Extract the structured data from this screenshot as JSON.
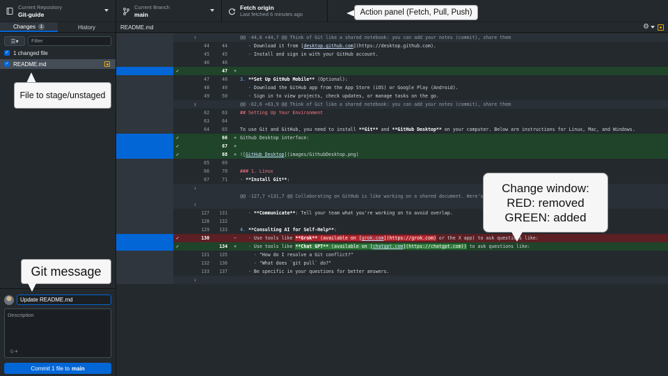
{
  "toolbar": {
    "repo": {
      "label": "Current Repository",
      "value": "Git-guide"
    },
    "branch": {
      "label": "Current Branch",
      "value": "main"
    },
    "fetch": {
      "label": "Fetch origin",
      "value": "Last fetched 6 minutes ago"
    }
  },
  "sidebar": {
    "tabs": [
      {
        "label": "Changes",
        "badge": "1"
      },
      {
        "label": "History"
      }
    ],
    "filter_placeholder": "Filter",
    "changed_count": "1 changed file",
    "file": "README.md"
  },
  "commit": {
    "summary": "Update README.md",
    "description_placeholder": "Description",
    "button_prefix": "Commit 1 file to",
    "button_branch": "main"
  },
  "diff": {
    "filename": "README.md",
    "lines": [
      {
        "type": "hunk",
        "expand": "up",
        "old": "",
        "new": "",
        "mark": "",
        "text": "@@ -44,6 +44,7 @@ Think of Git like a shared notebook: you can add your notes (commit), share them"
      },
      {
        "type": "ctx",
        "old": "44",
        "new": "44",
        "mark": "",
        "text": "   - Download it from [desktop.github.com](https://desktop.github.com)."
      },
      {
        "type": "ctx",
        "old": "45",
        "new": "45",
        "mark": "",
        "text": "   - Install and sign in with your GitHub account."
      },
      {
        "type": "ctx",
        "old": "46",
        "new": "46",
        "mark": "",
        "text": ""
      },
      {
        "type": "add",
        "sel": true,
        "old": "",
        "new": "47",
        "mark": "+",
        "text": ""
      },
      {
        "type": "ctx",
        "old": "47",
        "new": "48",
        "mark": "",
        "text": "3. **Set Up GitHub Mobile** (Optional):"
      },
      {
        "type": "ctx",
        "old": "48",
        "new": "49",
        "mark": "",
        "text": "   - Download the GitHub app from the App Store (iOS) or Google Play (Android)."
      },
      {
        "type": "ctx",
        "old": "49",
        "new": "50",
        "mark": "",
        "text": "   - Sign in to view projects, check updates, or manage tasks on the go."
      },
      {
        "type": "hunk",
        "expand": "both",
        "old": "",
        "new": "",
        "mark": "",
        "text": "@@ -62,6 +63,9 @@ Think of Git like a shared notebook: you can add your notes (commit), share them"
      },
      {
        "type": "ctx",
        "old": "62",
        "new": "63",
        "mark": "",
        "text": "## Setting Up Your Environment"
      },
      {
        "type": "ctx",
        "old": "63",
        "new": "64",
        "mark": "",
        "text": ""
      },
      {
        "type": "ctx",
        "old": "64",
        "new": "65",
        "mark": "",
        "text": "To use Git and GitHub, you need to install **Git** and **GitHub Desktop** on your computer. Below are instructions for Linux, Mac, and Windows."
      },
      {
        "type": "add",
        "sel": true,
        "old": "",
        "new": "66",
        "mark": "+",
        "text": "Github Desktop interface:"
      },
      {
        "type": "add",
        "sel": true,
        "old": "",
        "new": "67",
        "mark": "+",
        "text": ""
      },
      {
        "type": "add",
        "sel": true,
        "old": "",
        "new": "68",
        "mark": "+",
        "text": "![GitHub Desktop](images/GithubDesktop.png)"
      },
      {
        "type": "ctx",
        "old": "65",
        "new": "69",
        "mark": "",
        "text": ""
      },
      {
        "type": "ctx",
        "old": "66",
        "new": "70",
        "mark": "",
        "text": "### 1. Linux"
      },
      {
        "type": "ctx",
        "old": "67",
        "new": "71",
        "mark": "",
        "text": "- **Install Git**:"
      },
      {
        "type": "hunk",
        "expand": "down",
        "old": "",
        "new": "",
        "mark": "",
        "text": ""
      },
      {
        "type": "hunk",
        "expand": "none",
        "old": "",
        "new": "",
        "mark": "",
        "text": "@@ -127,7 +131,7 @@ Collaborating on GitHub is like working on a shared document. Here's how to do"
      },
      {
        "type": "hunk",
        "expand": "up",
        "old": "",
        "new": "",
        "mark": "",
        "text": ""
      },
      {
        "type": "ctx",
        "old": "127",
        "new": "131",
        "mark": "",
        "text": "   - **Communicate**: Tell your team what you're working on to avoid overlap."
      },
      {
        "type": "ctx",
        "old": "128",
        "new": "132",
        "mark": "",
        "text": ""
      },
      {
        "type": "ctx",
        "old": "129",
        "new": "133",
        "mark": "",
        "text": "4. **Consulting AI for Self-Help**:"
      },
      {
        "type": "del",
        "sel": true,
        "old": "130",
        "new": "",
        "mark": "−",
        "text": "   - Use tools like **Grok** (available on [grok.com](https://grok.com) or the X app) to ask questions like:"
      },
      {
        "type": "add",
        "sel": true,
        "old": "",
        "new": "134",
        "mark": "+",
        "text": "   - Use tools like **Chat GPT** (available on [chatgpt.com](https://chatgpt.com)) to ask questions like:"
      },
      {
        "type": "ctx",
        "old": "131",
        "new": "135",
        "mark": "",
        "text": "     - \"How do I resolve a Git conflict?\""
      },
      {
        "type": "ctx",
        "old": "132",
        "new": "136",
        "mark": "",
        "text": "     - \"What does `git pull` do?\""
      },
      {
        "type": "ctx",
        "old": "133",
        "new": "137",
        "mark": "",
        "text": "   - Be specific in your questions for better answers."
      },
      {
        "type": "hunk",
        "expand": "down",
        "old": "",
        "new": "",
        "mark": "",
        "text": ""
      }
    ]
  },
  "callouts": {
    "action": "Action panel (Fetch, Pull, Push)",
    "file": "File to stage/unstaged",
    "git_message": "Git message",
    "change_title": "Change window:",
    "change_red": "RED: removed",
    "change_green": "GREEN: added"
  },
  "icons": {
    "repo": "repo-icon",
    "branch": "branch-icon",
    "fetch": "sync-icon",
    "settings": "gear-icon"
  }
}
